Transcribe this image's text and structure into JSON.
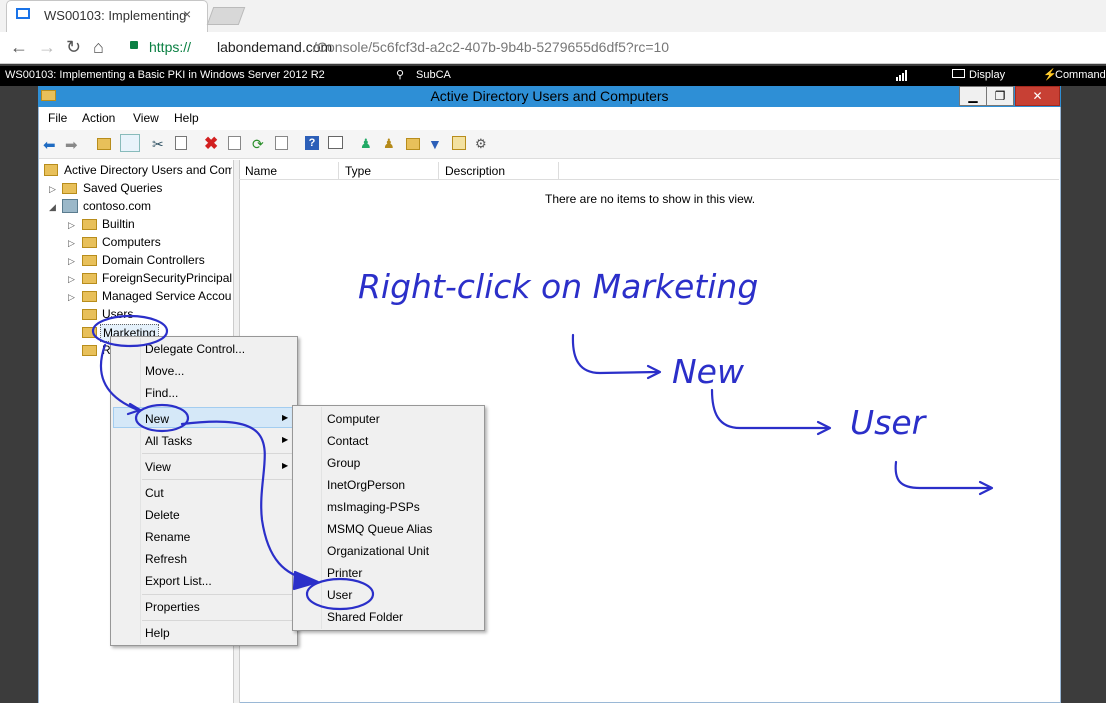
{
  "browser": {
    "tab_title": "WS00103: Implementing",
    "tab_close": "×",
    "url_scheme": "https://",
    "url_host": "labondemand.com",
    "url_path": "/Console/5c6fcf3d-a2c2-407b-9b4b-5279655d6df5?rc=10"
  },
  "lab_bar": {
    "title": "WS00103: Implementing a Basic PKI in Windows Server 2012 R2",
    "machine": "SubCA",
    "display_label": "Display",
    "commands_label": "Command"
  },
  "window": {
    "title": "Active Directory Users and Computers",
    "min_glyph": "▁",
    "restore_glyph": "❐",
    "close_glyph": "✕"
  },
  "menubar": [
    "File",
    "Action",
    "View",
    "Help"
  ],
  "tree": {
    "root": "Active Directory Users and Com",
    "saved_queries": "Saved Queries",
    "domain": "contoso.com",
    "children": [
      "Builtin",
      "Computers",
      "Domain Controllers",
      "ForeignSecurityPrincipals",
      "Managed Service Accour",
      "Users",
      "Marketing",
      "R"
    ]
  },
  "list": {
    "columns": [
      "Name",
      "Type",
      "Description"
    ],
    "empty_message": "There are no items to show in this view."
  },
  "context_menu": {
    "items": [
      "Delegate Control...",
      "Move...",
      "Find...",
      "New",
      "All Tasks",
      "View",
      "Cut",
      "Delete",
      "Rename",
      "Refresh",
      "Export List...",
      "Properties",
      "Help"
    ]
  },
  "new_submenu": {
    "items": [
      "Computer",
      "Contact",
      "Group",
      "InetOrgPerson",
      "msImaging-PSPs",
      "MSMQ Queue Alias",
      "Organizational Unit",
      "Printer",
      "User",
      "Shared Folder"
    ]
  },
  "annotation": {
    "instruction": "Right-click on Marketing",
    "step1": "New",
    "step2": "User",
    "ink_color": "#2b2fc9"
  }
}
